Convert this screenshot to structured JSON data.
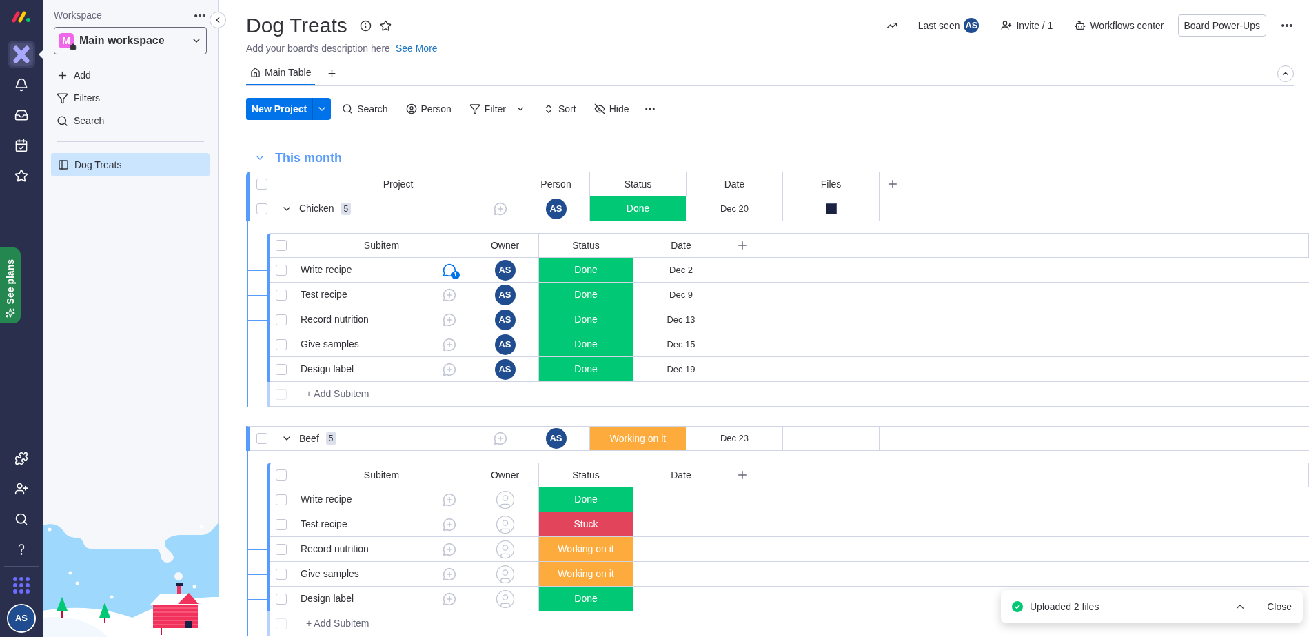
{
  "rail": {
    "items": [
      {
        "selected": true
      },
      {
        "selected": false
      },
      {
        "selected": false
      },
      {
        "selected": false
      },
      {
        "selected": false
      }
    ],
    "see_plans": "See plans",
    "avatar": "AS"
  },
  "sidebar": {
    "heading": "Workspace",
    "workspace": {
      "badge": "M",
      "name": "Main workspace"
    },
    "actions": [
      "Add",
      "Filters",
      "Search"
    ],
    "boards": [
      {
        "label": "Dog Treats",
        "selected": true
      }
    ]
  },
  "board": {
    "title": "Dog Treats",
    "description": "Add your board's description here",
    "see_more": "See More"
  },
  "header_actions": {
    "last_seen": "Last seen",
    "last_seen_avatar": "AS",
    "invite": "Invite / 1",
    "workflows": "Workflows center",
    "power_ups": "Board Power-Ups"
  },
  "tabs": [
    {
      "label": "Main Table",
      "selected": true
    }
  ],
  "toolbar": {
    "primary": "New Project",
    "items": [
      "Search",
      "Person",
      "Filter",
      "Sort",
      "Hide"
    ]
  },
  "groups": [
    {
      "title": "This month",
      "color": "#579bfc",
      "expanded": true,
      "all_checked": false,
      "columns": [
        "Project",
        "Person",
        "Status",
        "Date",
        "Files"
      ],
      "items": [
        {
          "name": "Chicken",
          "count": "5",
          "checked": false,
          "expanded": true,
          "person": "AS",
          "status": {
            "label": "Done",
            "color": "#00c875"
          },
          "date": "Dec 20",
          "has_file": true,
          "subitems": {
            "columns": [
              "Subitem",
              "Owner",
              "Status",
              "Date"
            ],
            "all_checked": false,
            "add_checkbox_disabled": true,
            "add_label": "+ Add Subitem",
            "rows": [
              {
                "name": "Write recipe",
                "checked": false,
                "comments": "1",
                "owner": {
                  "kind": "avatar",
                  "initials": "AS"
                },
                "status": {
                  "label": "Done",
                  "color": "#00c875"
                },
                "date": "Dec 2"
              },
              {
                "name": "Test recipe",
                "checked": false,
                "owner": {
                  "kind": "avatar",
                  "initials": "AS"
                },
                "status": {
                  "label": "Done",
                  "color": "#00c875"
                },
                "date": "Dec 9"
              },
              {
                "name": "Record nutrition",
                "checked": false,
                "owner": {
                  "kind": "avatar",
                  "initials": "AS"
                },
                "status": {
                  "label": "Done",
                  "color": "#00c875"
                },
                "date": "Dec 13"
              },
              {
                "name": "Give samples",
                "checked": false,
                "owner": {
                  "kind": "avatar",
                  "initials": "AS"
                },
                "status": {
                  "label": "Done",
                  "color": "#00c875"
                },
                "date": "Dec 15"
              },
              {
                "name": "Design label",
                "checked": false,
                "owner": {
                  "kind": "avatar",
                  "initials": "AS"
                },
                "status": {
                  "label": "Done",
                  "color": "#00c875"
                },
                "date": "Dec 19"
              }
            ]
          }
        },
        {
          "name": "Beef",
          "count": "5",
          "checked": false,
          "expanded": true,
          "person": "AS",
          "status": {
            "label": "Working on it",
            "color": "#fdab3d"
          },
          "date": "Dec 23",
          "has_file": false,
          "subitems": {
            "columns": [
              "Subitem",
              "Owner",
              "Status",
              "Date"
            ],
            "all_checked": false,
            "add_checkbox_disabled": true,
            "add_label": "+ Add Subitem",
            "rows": [
              {
                "name": "Write recipe",
                "checked": false,
                "owner": {
                  "kind": "empty"
                },
                "status": {
                  "label": "Done",
                  "color": "#00c875"
                }
              },
              {
                "name": "Test recipe",
                "checked": false,
                "owner": {
                  "kind": "empty"
                },
                "status": {
                  "label": "Stuck",
                  "color": "#e2445c"
                }
              },
              {
                "name": "Record nutrition",
                "checked": false,
                "owner": {
                  "kind": "empty"
                },
                "status": {
                  "label": "Working on it",
                  "color": "#fdab3d"
                }
              },
              {
                "name": "Give samples",
                "checked": false,
                "owner": {
                  "kind": "empty"
                },
                "status": {
                  "label": "Working on it",
                  "color": "#fdab3d"
                }
              },
              {
                "name": "Design label",
                "checked": false,
                "owner": {
                  "kind": "empty"
                },
                "status": {
                  "label": "Done",
                  "color": "#00c875"
                }
              }
            ]
          }
        }
      ]
    }
  ],
  "toast": {
    "message": "Uploaded 2 files",
    "close": "Close"
  }
}
